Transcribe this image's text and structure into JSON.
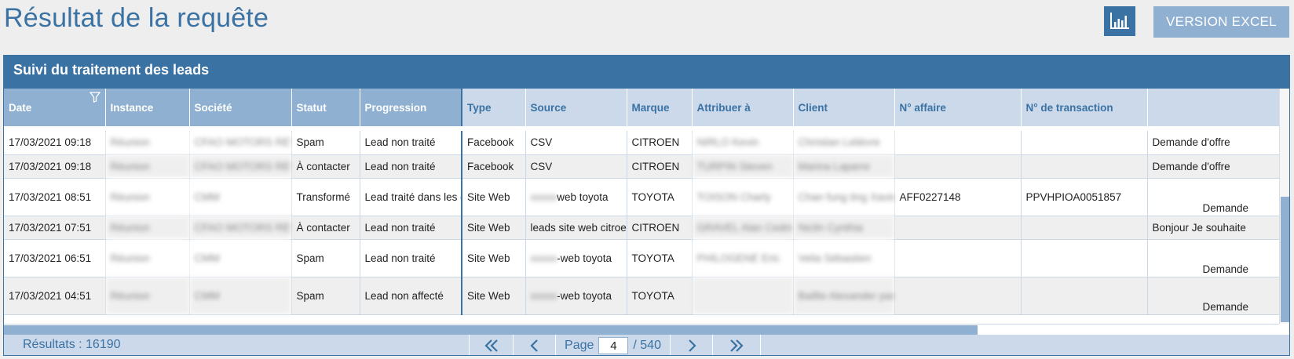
{
  "header": {
    "title": "Résultat de la requête",
    "excel_button": "VERSION EXCEL",
    "chart_button_icon": "bar-chart-icon"
  },
  "panel": {
    "title": "Suivi du traitement des leads"
  },
  "columns": [
    "Date",
    "Instance",
    "Société",
    "Statut",
    "Progression",
    "Type",
    "Source",
    "Marque",
    "Attribuer à",
    "Client",
    "N° affaire",
    "N° de transaction",
    ""
  ],
  "rows": [
    {
      "date": "17/03/2021 09:18",
      "instance": "Réunion",
      "societe": "CFAO MOTORS REUNION",
      "statut": "Spam",
      "progression": "Lead non traité",
      "type": "Facebook",
      "source": "CSV",
      "marque": "CITROEN",
      "attribuer": "NIRLO Kevin",
      "client": "Christian Lelièvre",
      "affaire": "",
      "transaction": "",
      "extra": "Demande d'offre"
    },
    {
      "date": "17/03/2021 09:18",
      "instance": "Réunion",
      "societe": "CFAO MOTORS REUNION",
      "statut": "À contacter",
      "progression": "Lead non traité",
      "type": "Facebook",
      "source": "CSV",
      "marque": "CITROEN",
      "attribuer": "TURPIN Steven",
      "client": "Marina Laparre",
      "affaire": "",
      "transaction": "",
      "extra": "Demande d'offre"
    },
    {
      "date": "17/03/2021 08:51",
      "instance": "Réunion",
      "societe": "CMM",
      "statut": "Transformé",
      "progression": "Lead traité dans les délais",
      "type": "Site Web",
      "source_blur": "xxxxx",
      "source": "web toyota",
      "marque": "TOYOTA",
      "attribuer": "TOISON Charly",
      "client": "Chan fung ting Xavier",
      "affaire": "AFF0227148",
      "transaction": "PPVHPIOA0051857",
      "extra": "Demande"
    },
    {
      "date": "17/03/2021 07:51",
      "instance": "Réunion",
      "societe": "CFAO MOTORS REUNION",
      "statut": "À contacter",
      "progression": "Lead non traité",
      "type": "Site Web",
      "source": "leads site web citroen",
      "marque": "CITROEN",
      "attribuer": "GRAVEL Alan Cedric",
      "client": "Niclin Cynthia",
      "affaire": "",
      "transaction": "",
      "extra": "Bonjour Je souhaite"
    },
    {
      "date": "17/03/2021 06:51",
      "instance": "Réunion",
      "societe": "CMM",
      "statut": "Spam",
      "progression": "Lead non traité",
      "type": "Site Web",
      "source_blur": "xxxxx",
      "source": "-web toyota",
      "marque": "TOYOTA",
      "attribuer": "PHILOGENE Eric",
      "client": "Velia Sébastien",
      "affaire": "",
      "transaction": "",
      "extra": "Demande"
    },
    {
      "date": "17/03/2021 04:51",
      "instance": "Réunion",
      "societe": "CMM",
      "statut": "Spam",
      "progression": "Lead non affecté",
      "type": "Site Web",
      "source_blur": "xxxxx",
      "source": "-web toyota",
      "marque": "TOYOTA",
      "attribuer": "",
      "client": "Baillie Alexander pascal",
      "affaire": "",
      "transaction": "",
      "extra": "Demande"
    }
  ],
  "pager": {
    "results_label": "Résultats : 16190",
    "page_label": "Page",
    "current_page": "4",
    "total_label": "/ 540",
    "first_icon": "double-chevron-left-icon",
    "prev_icon": "chevron-left-icon",
    "next_icon": "chevron-right-icon",
    "last_icon": "double-chevron-right-icon"
  },
  "colors": {
    "accent": "#3a72a3",
    "accent_light": "#8fb0d1",
    "header_light": "#cbd9ea"
  }
}
